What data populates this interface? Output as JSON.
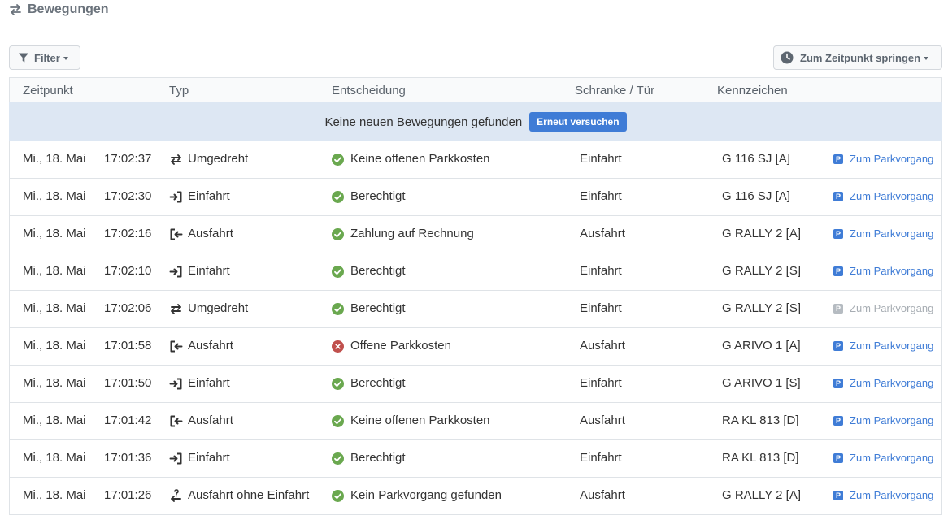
{
  "header": {
    "title": "Bewegungen"
  },
  "toolbar": {
    "filter_label": "Filter",
    "jump_label": "Zum Zeitpunkt springen"
  },
  "table": {
    "columns": [
      "Zeitpunkt",
      "Typ",
      "Entscheidung",
      "Schranke / Tür",
      "Kennzeichen"
    ],
    "notice": {
      "text": "Keine neuen Bewegungen gefunden",
      "retry_label": "Erneut versuchen"
    },
    "rows": [
      {
        "date": "Mi., 18. Mai",
        "time": "17:02:37",
        "typ": "Umgedreht",
        "typ_icon": "turnaround-icon",
        "decision": "Keine offenen Parkkosten",
        "decision_status": "ok",
        "gate": "Einfahrt",
        "plate": "G 116 SJ [A]",
        "link": "Zum Parkvorgang",
        "link_enabled": true
      },
      {
        "date": "Mi., 18. Mai",
        "time": "17:02:30",
        "typ": "Einfahrt",
        "typ_icon": "entry-icon",
        "decision": "Berechtigt",
        "decision_status": "ok",
        "gate": "Einfahrt",
        "plate": "G 116 SJ [A]",
        "link": "Zum Parkvorgang",
        "link_enabled": true
      },
      {
        "date": "Mi., 18. Mai",
        "time": "17:02:16",
        "typ": "Ausfahrt",
        "typ_icon": "exit-icon",
        "decision": "Zahlung auf Rechnung",
        "decision_status": "ok",
        "gate": "Ausfahrt",
        "plate": "G RALLY 2 [A]",
        "link": "Zum Parkvorgang",
        "link_enabled": true
      },
      {
        "date": "Mi., 18. Mai",
        "time": "17:02:10",
        "typ": "Einfahrt",
        "typ_icon": "entry-icon",
        "decision": "Berechtigt",
        "decision_status": "ok",
        "gate": "Einfahrt",
        "plate": "G RALLY 2 [S]",
        "link": "Zum Parkvorgang",
        "link_enabled": true
      },
      {
        "date": "Mi., 18. Mai",
        "time": "17:02:06",
        "typ": "Umgedreht",
        "typ_icon": "turnaround-icon",
        "decision": "Berechtigt",
        "decision_status": "ok",
        "gate": "Einfahrt",
        "plate": "G RALLY 2 [S]",
        "link": "Zum Parkvorgang",
        "link_enabled": false
      },
      {
        "date": "Mi., 18. Mai",
        "time": "17:01:58",
        "typ": "Ausfahrt",
        "typ_icon": "exit-icon",
        "decision": "Offene Parkkosten",
        "decision_status": "denied",
        "gate": "Ausfahrt",
        "plate": "G ARIVO 1 [A]",
        "link": "Zum Parkvorgang",
        "link_enabled": true
      },
      {
        "date": "Mi., 18. Mai",
        "time": "17:01:50",
        "typ": "Einfahrt",
        "typ_icon": "entry-icon",
        "decision": "Berechtigt",
        "decision_status": "ok",
        "gate": "Einfahrt",
        "plate": "G ARIVO 1 [S]",
        "link": "Zum Parkvorgang",
        "link_enabled": true
      },
      {
        "date": "Mi., 18. Mai",
        "time": "17:01:42",
        "typ": "Ausfahrt",
        "typ_icon": "exit-icon",
        "decision": "Keine offenen Parkkosten",
        "decision_status": "ok",
        "gate": "Ausfahrt",
        "plate": "RA KL 813 [D]",
        "link": "Zum Parkvorgang",
        "link_enabled": true
      },
      {
        "date": "Mi., 18. Mai",
        "time": "17:01:36",
        "typ": "Einfahrt",
        "typ_icon": "entry-icon",
        "decision": "Berechtigt",
        "decision_status": "ok",
        "gate": "Einfahrt",
        "plate": "RA KL 813 [D]",
        "link": "Zum Parkvorgang",
        "link_enabled": true
      },
      {
        "date": "Mi., 18. Mai",
        "time": "17:01:26",
        "typ": "Ausfahrt ohne Einfahrt",
        "typ_icon": "exit-without-entry-icon",
        "decision": "Kein Parkvorgang gefunden",
        "decision_status": "ok",
        "gate": "Ausfahrt",
        "plate": "G RALLY 2 [A]",
        "link": "Zum Parkvorgang",
        "link_enabled": true
      }
    ]
  },
  "colors": {
    "accent": "#3f7cd6",
    "ok": "#6aa84f",
    "denied": "#c0504d",
    "notice_bg": "#dde7f3"
  }
}
